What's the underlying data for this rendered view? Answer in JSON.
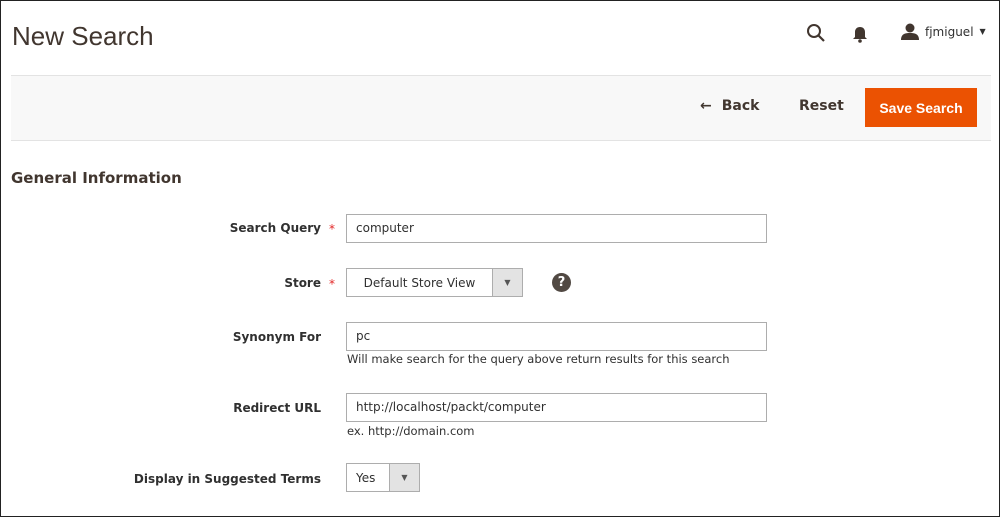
{
  "header": {
    "title": "New Search",
    "user": "fjmiguel"
  },
  "actions": {
    "back": "Back",
    "reset": "Reset",
    "save": "Save Search",
    "accent": "#eb5202"
  },
  "section": "General Information",
  "form": {
    "search_query": {
      "label": "Search Query",
      "value": "computer",
      "required": "*"
    },
    "store": {
      "label": "Store",
      "value": "Default Store View",
      "required": "*",
      "help": "?"
    },
    "synonym": {
      "label": "Synonym For",
      "value": "pc",
      "note": "Will make search for the query above return results for this search"
    },
    "redirect": {
      "label": "Redirect URL",
      "value": "http://localhost/packt/computer",
      "note": "ex. http://domain.com"
    },
    "suggested": {
      "label": "Display in Suggested Terms",
      "value": "Yes"
    }
  }
}
